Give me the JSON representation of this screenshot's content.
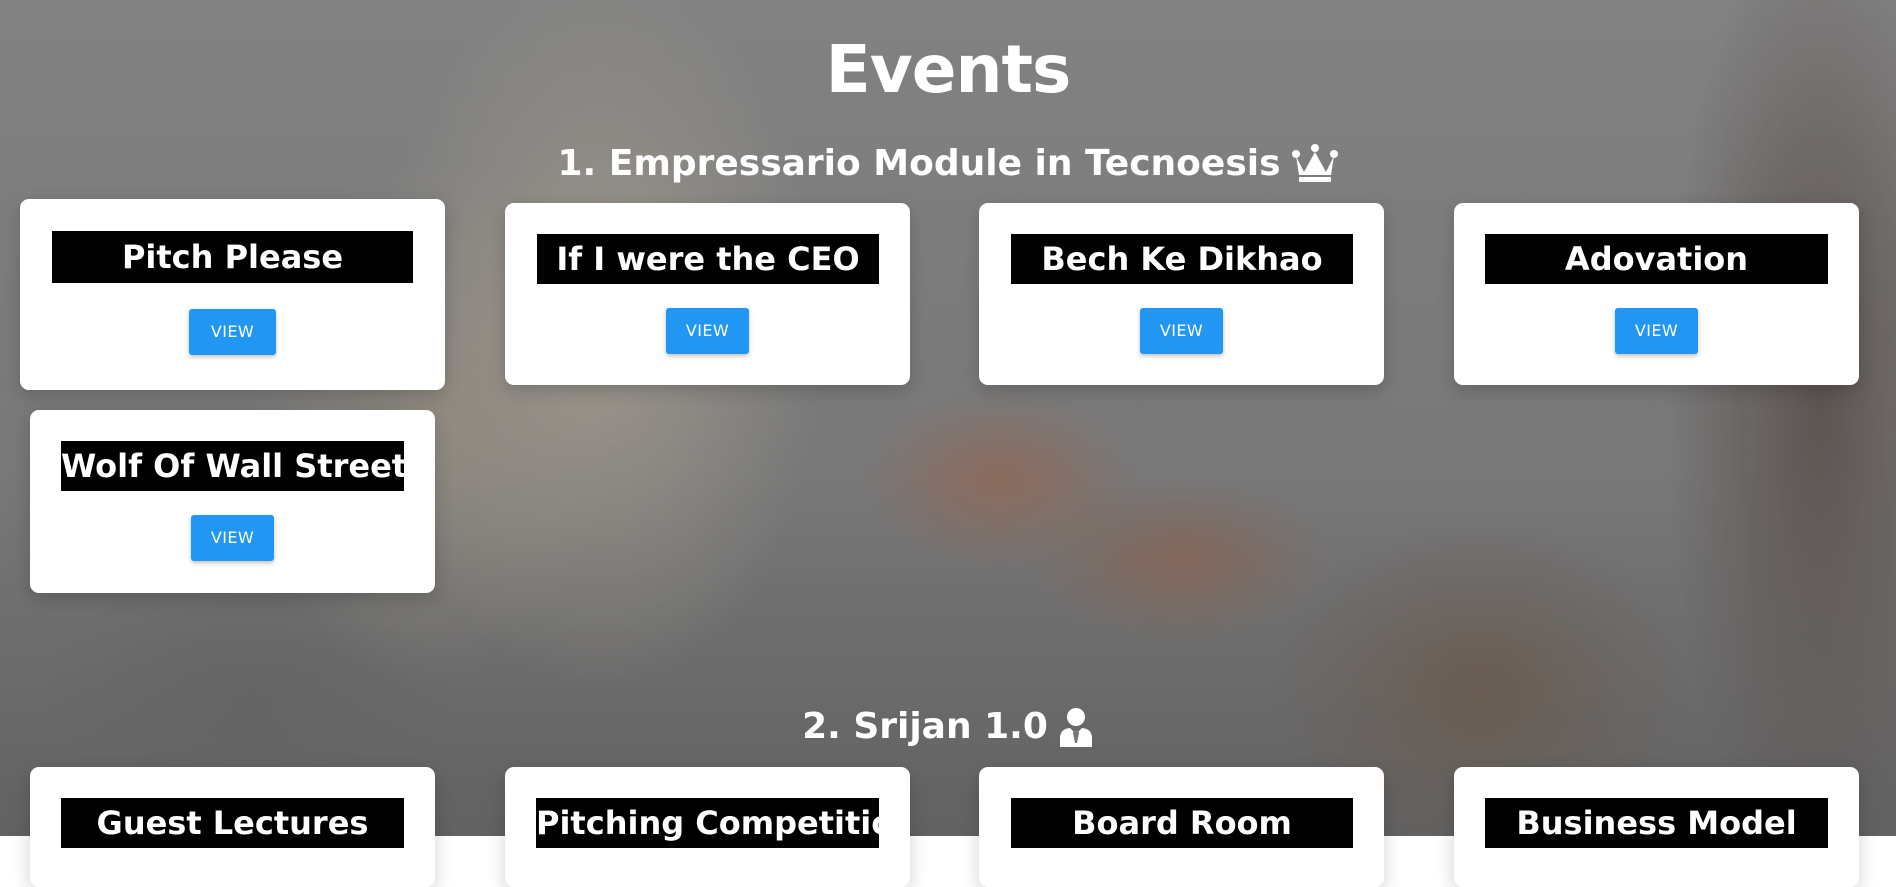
{
  "page": {
    "title": "Events"
  },
  "sections": [
    {
      "title": "1. Empressario Module in Tecnoesis",
      "icon": "crown-icon",
      "events": [
        {
          "name": "Pitch Please",
          "button_label": "VIEW"
        },
        {
          "name": "If I were the CEO",
          "button_label": "VIEW"
        },
        {
          "name": "Bech Ke Dikhao",
          "button_label": "VIEW"
        },
        {
          "name": "Adovation",
          "button_label": "VIEW"
        },
        {
          "name": "Wolf Of Wall Street",
          "button_label": "VIEW"
        }
      ]
    },
    {
      "title": "2. Srijan 1.0",
      "icon": "user-tie-icon",
      "events": [
        {
          "name": "Guest Lectures"
        },
        {
          "name": "Pitching Competition"
        },
        {
          "name": "Board Room"
        },
        {
          "name": "Business Model"
        }
      ]
    }
  ],
  "colors": {
    "button": "#2196f3",
    "card": "#ffffff",
    "title_bar": "#000000"
  }
}
